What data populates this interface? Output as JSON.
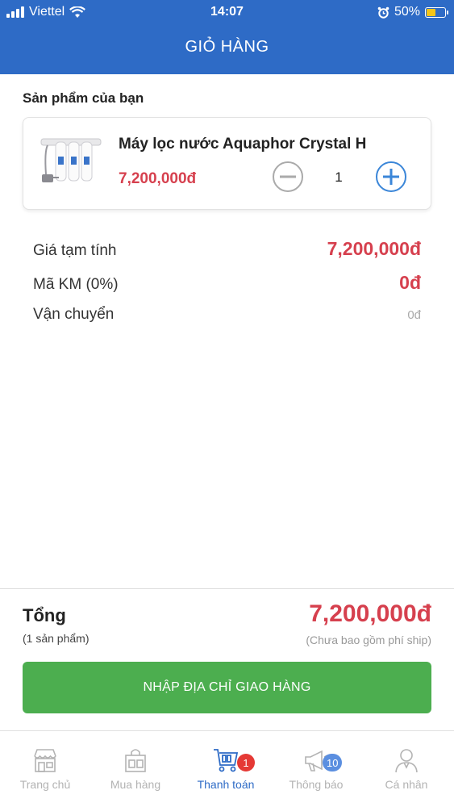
{
  "status_bar": {
    "carrier": "Viettel",
    "time": "14:07",
    "battery": "50%",
    "battery_level": 0.5
  },
  "header": {
    "title": "GIỎ HÀNG"
  },
  "cart": {
    "section_label": "Sản phẩm của bạn",
    "items": [
      {
        "name": "Máy lọc nước Aquaphor Crystal H",
        "price": "7,200,000đ",
        "quantity": "1"
      }
    ]
  },
  "summary": {
    "subtotal_label": "Giá tạm tính",
    "subtotal_value": "7,200,000đ",
    "promo_label": "Mã KM (0%)",
    "promo_value": "0đ",
    "shipping_label": "Vận chuyển",
    "shipping_value": "0đ"
  },
  "total": {
    "label": "Tổng",
    "count": "(1 sản phẩm)",
    "amount": "7,200,000đ",
    "note": "(Chưa bao gồm phí ship)"
  },
  "cta": {
    "label": "NHẬP ĐỊA CHỈ GIAO HÀNG"
  },
  "tabbar": {
    "tabs": [
      {
        "label": "Trang chủ",
        "icon": "store-icon"
      },
      {
        "label": "Mua hàng",
        "icon": "shopping-bag-icon"
      },
      {
        "label": "Thanh toán",
        "icon": "cart-icon",
        "badge": "1",
        "active": true
      },
      {
        "label": "Thông báo",
        "icon": "megaphone-icon",
        "badge": "10"
      },
      {
        "label": "Cá nhân",
        "icon": "person-icon"
      }
    ]
  },
  "colors": {
    "primary": "#2e6bc6",
    "price": "#d6404e",
    "cta": "#4cae4f",
    "badge_red": "#e53935",
    "badge_blue": "#5b8fe0"
  }
}
